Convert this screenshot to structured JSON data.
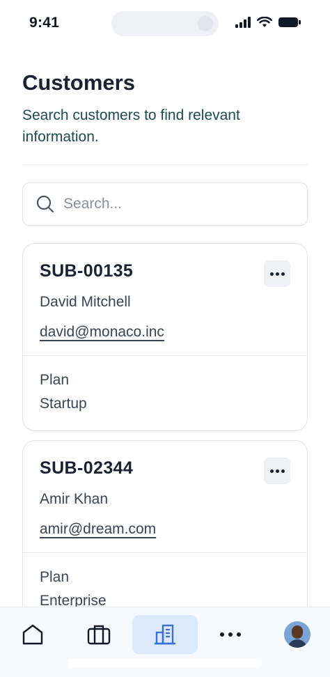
{
  "status_bar": {
    "time": "9:41"
  },
  "header": {
    "title": "Customers",
    "subtitle": "Search customers to find relevant information."
  },
  "search": {
    "placeholder": "Search...",
    "value": ""
  },
  "customers": [
    {
      "id": "SUB-00135",
      "name": "David Mitchell",
      "email": "david@monaco.inc",
      "plan_label": "Plan",
      "plan": "Startup"
    },
    {
      "id": "SUB-02344",
      "name": "Amir Khan",
      "email": "amir@dream.com",
      "plan_label": "Plan",
      "plan": "Enterprise"
    }
  ],
  "tab_bar": {
    "items": [
      {
        "icon": "home-icon"
      },
      {
        "icon": "briefcase-icon"
      },
      {
        "icon": "building-icon",
        "active": true
      },
      {
        "icon": "more-horizontal-icon"
      },
      {
        "icon": "avatar"
      }
    ],
    "active_color": "#dce8fb",
    "accent_color": "#3b6fd4"
  }
}
